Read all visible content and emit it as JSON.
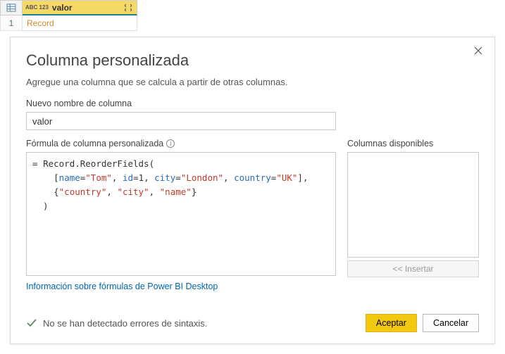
{
  "grid": {
    "column_type_badge": "ABC\n123",
    "column_name": "valor",
    "row1_number": "1",
    "row1_value": "Record"
  },
  "dialog": {
    "title": "Columna personalizada",
    "subtitle": "Agregue una columna que se calcula a partir de otras columnas.",
    "name_label": "Nuevo nombre de columna",
    "name_value": "valor",
    "formula_label": "Fórmula de columna personalizada",
    "formula": {
      "fn": "Record.ReorderFields",
      "name_key": "name",
      "name_val": "\"Tom\"",
      "id_key": "id",
      "id_val": "1",
      "city_key": "city",
      "city_val": "\"London\"",
      "country_key": "country",
      "country_val": "\"UK\"",
      "ord1": "\"country\"",
      "ord2": "\"city\"",
      "ord3": "\"name\""
    },
    "available_label": "Columnas disponibles",
    "insert_label": "<< Insertar",
    "help_link": "Información sobre fórmulas de Power BI Desktop",
    "status_text": "No se han detectado errores de sintaxis.",
    "ok_label": "Aceptar",
    "cancel_label": "Cancelar"
  }
}
